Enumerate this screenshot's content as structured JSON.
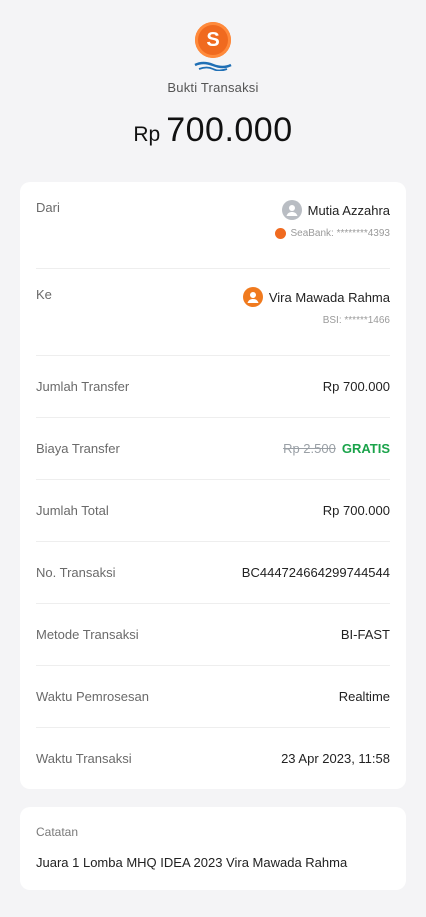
{
  "header": {
    "logo_icon": "seabank-logo-icon",
    "title": "Bukti Transaksi",
    "currency": "Rp",
    "amount": "700.000"
  },
  "details": {
    "from": {
      "label": "Dari",
      "name": "Mutia Azzahra",
      "account": "SeaBank: ********4393",
      "avatar_icon": "user-avatar-icon"
    },
    "to": {
      "label": "Ke",
      "name": "Vira Mawada Rahma",
      "account": "BSI: ******1466",
      "avatar_icon": "user-avatar-icon"
    },
    "rows": [
      {
        "label": "Jumlah Transfer",
        "value": "Rp 700.000"
      },
      {
        "label": "Biaya Transfer",
        "old_value": "Rp 2.500",
        "value": "GRATIS"
      },
      {
        "label": "Jumlah Total",
        "value": "Rp 700.000"
      },
      {
        "label": "No. Transaksi",
        "value": "BC444724664299744544"
      },
      {
        "label": "Metode Transaksi",
        "value": "BI-FAST"
      },
      {
        "label": "Waktu Pemrosesan",
        "value": "Realtime"
      },
      {
        "label": "Waktu Transaksi",
        "value": "23 Apr 2023, 11:58"
      }
    ]
  },
  "note": {
    "label": "Catatan",
    "text": "Juara 1 Lomba MHQ IDEA 2023 Vira Mawada Rahma"
  },
  "colors": {
    "brand": "#f06a1f",
    "free": "#1aa34a"
  }
}
